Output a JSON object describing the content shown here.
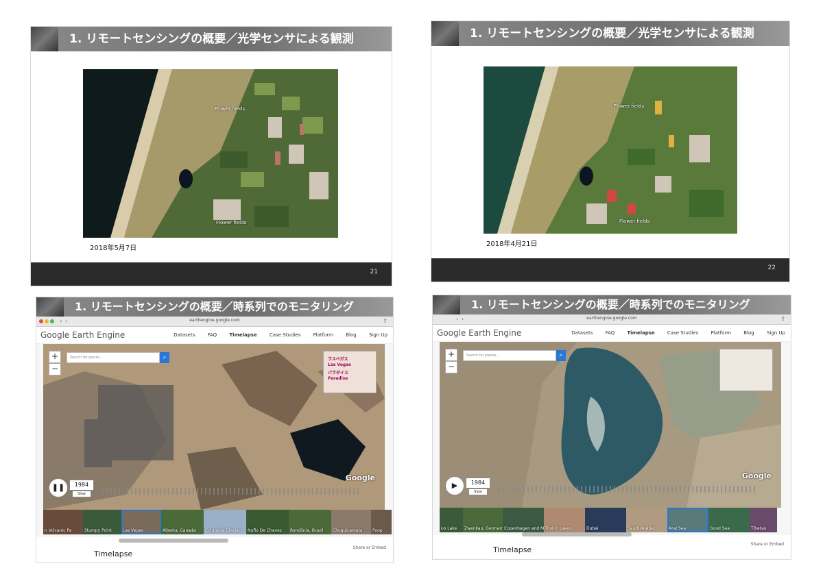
{
  "slides": [
    {
      "title": "1. リモートセンシングの概要／光学センサによる観測",
      "date": "2018年5月7日",
      "page": "21",
      "labels": [
        "Flower fields",
        "Flower fields"
      ]
    },
    {
      "title": "1. リモートセンシングの概要／光学センサによる観測",
      "date": "2018年4月21日",
      "page": "22",
      "labels": [
        "Flower fields",
        "Flower fields"
      ]
    },
    {
      "title": "1. リモートセンシングの概要／時系列でのモニタリング",
      "url": "earthengine.google.com",
      "search_placeholder": "Search for places...",
      "year": "1984",
      "speed": "Slow",
      "footer": "Timelapse",
      "share": "Share or Embed",
      "minimap": [
        "ラスベガス",
        "Las Vegas",
        "パラダイス",
        "Paradise"
      ],
      "thumbs": [
        "n Volcanic Pa",
        "Stumpy Point",
        "Las Vegas",
        "Alberta, Canada",
        "Columbia Glacier",
        "Nuflo De Chavez",
        "Rondônia, Brazil",
        "Chuquicamata",
        "Poop"
      ]
    },
    {
      "title": "1. リモートセンシングの概要／時系列でのモニタリング",
      "url": "earthengine.google.com",
      "search_placeholder": "Search for places...",
      "year": "1984",
      "speed": "Slow",
      "footer": "Timelapse",
      "share": "Share or Embed",
      "thumbs": [
        "oo Lake",
        "Zwenkau, Germany",
        "Copenhagen and M",
        "Tonkin Lakes",
        "Dubai",
        "Saudi Arabia",
        "Aral Sea",
        "Good Sea",
        "Tibetan"
      ]
    }
  ],
  "gee": {
    "logo": "Google Earth Engine",
    "nav": [
      "Datasets",
      "FAQ",
      "Timelapse",
      "Case Studies",
      "Platform",
      "Blog",
      "Sign Up"
    ],
    "google_mark": "Google"
  },
  "colors": {
    "accent": "#2a78d6",
    "title_bar": "#7a7a7a",
    "footer_bar": "#2a2a2a"
  }
}
